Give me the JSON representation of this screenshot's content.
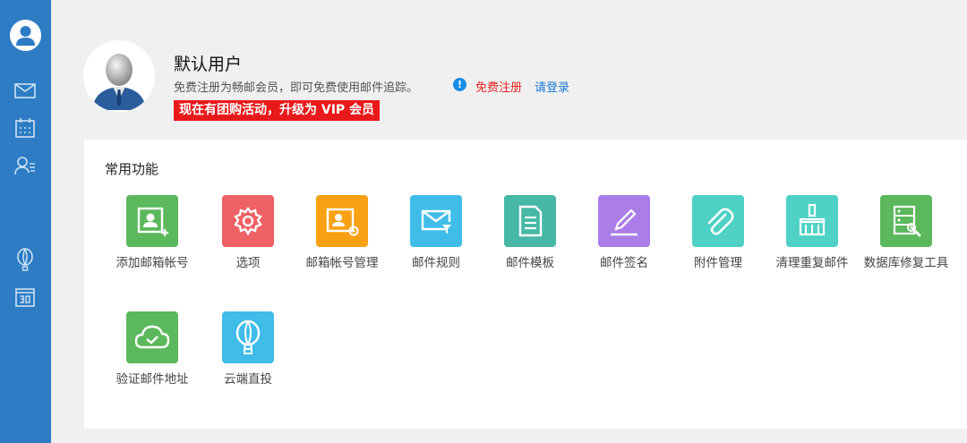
{
  "user": {
    "name": "默认用户",
    "description": "免费注册为畅邮会员，即可免费使用邮件追踪。",
    "register_link": "免费注册",
    "login_link": "请登录",
    "promo_banner": "现在有团购活动，升级为 VIP 会员"
  },
  "section": {
    "title": "常用功能"
  },
  "features": [
    {
      "label": "添加邮箱帐号",
      "color": "#5cb85c",
      "icon": "add-account-icon"
    },
    {
      "label": "选项",
      "color": "#ee6164",
      "icon": "gear-icon"
    },
    {
      "label": "邮箱帐号管理",
      "color": "#f8a115",
      "icon": "account-settings-icon"
    },
    {
      "label": "邮件规则",
      "color": "#40bce9",
      "icon": "mail-filter-icon"
    },
    {
      "label": "邮件模板",
      "color": "#46b8a5",
      "icon": "document-icon"
    },
    {
      "label": "邮件签名",
      "color": "#aa7de8",
      "icon": "pen-icon"
    },
    {
      "label": "附件管理",
      "color": "#4fd1c5",
      "icon": "paperclip-icon"
    },
    {
      "label": "清理重复邮件",
      "color": "#4fd1c5",
      "icon": "broom-icon"
    },
    {
      "label": "数据库修复工具",
      "color": "#5cb85c",
      "icon": "database-repair-icon"
    },
    {
      "label": "验证邮件地址",
      "color": "#5cb85c",
      "icon": "cloud-check-icon"
    },
    {
      "label": "云端直投",
      "color": "#40bce9",
      "icon": "balloon-icon"
    }
  ],
  "colors": {
    "sidebar": "#2d7cc4",
    "register_link": "#e8211e",
    "login_link": "#1a7ad8",
    "promo_banner": "#e8191a"
  },
  "sidebar_icons": [
    "user-avatar-icon",
    "mail-icon",
    "calendar-icon",
    "contacts-icon",
    "balloon-icon",
    "calendar-day-icon"
  ]
}
